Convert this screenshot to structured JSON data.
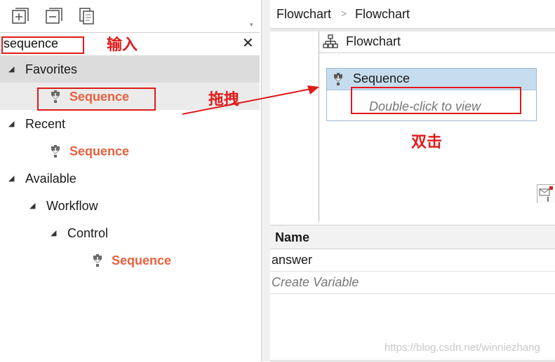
{
  "toolbar": {
    "expand_icon": "expand-all-icon",
    "collapse_icon": "collapse-all-icon",
    "copy_icon": "copy-icon"
  },
  "search": {
    "value": "sequence",
    "clear_icon": "close-icon",
    "clear_label": "✕"
  },
  "tree": {
    "favorites": {
      "label": "Favorites",
      "item": "Sequence"
    },
    "recent": {
      "label": "Recent",
      "item": "Sequence"
    },
    "available": {
      "label": "Available",
      "workflow": {
        "label": "Workflow",
        "control": {
          "label": "Control",
          "item": "Sequence"
        }
      }
    }
  },
  "breadcrumb": {
    "items": [
      "Flowchart",
      "Flowchart"
    ],
    "separator": ">"
  },
  "designer": {
    "flowchart_title": "Flowchart",
    "sequence_title": "Sequence",
    "sequence_hint": "Double-click to view"
  },
  "variables": {
    "header": "Name",
    "rows": [
      "answer"
    ],
    "create_label": "Create Variable"
  },
  "annotations": {
    "input": "输入",
    "drag": "拖拽",
    "double_click": "双击",
    "color": "#e01b1b"
  },
  "watermark": "https://blog.csdn.net/winniezhang",
  "colors": {
    "sequence_text": "#e8613f",
    "selected_row": "#dcdcdc",
    "sequence_header": "#c6ddf0"
  }
}
